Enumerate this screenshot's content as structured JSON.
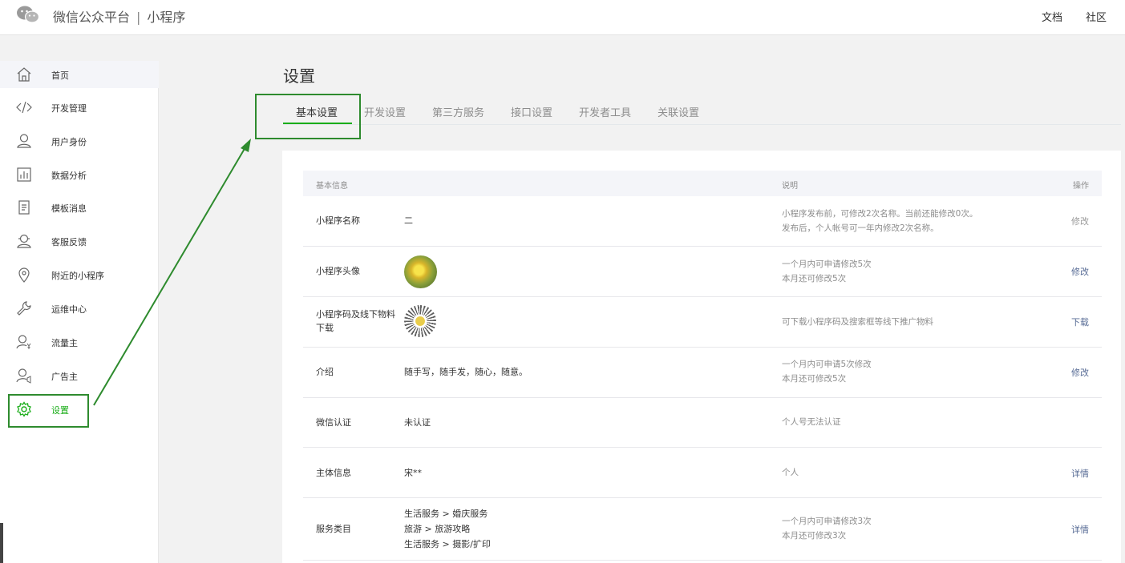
{
  "header": {
    "brand": "微信公众平台",
    "separator": "|",
    "product": "小程序",
    "links": [
      "文档",
      "社区"
    ]
  },
  "sidebar": {
    "items": [
      {
        "label": "首页",
        "icon": "home-icon"
      },
      {
        "label": "开发管理",
        "icon": "code-icon"
      },
      {
        "label": "用户身份",
        "icon": "user-icon"
      },
      {
        "label": "数据分析",
        "icon": "chart-icon"
      },
      {
        "label": "模板消息",
        "icon": "document-icon"
      },
      {
        "label": "客服反馈",
        "icon": "service-icon"
      },
      {
        "label": "附近的小程序",
        "icon": "location-icon"
      },
      {
        "label": "运维中心",
        "icon": "wrench-icon"
      },
      {
        "label": "流量主",
        "icon": "user-yen-icon"
      },
      {
        "label": "广告主",
        "icon": "user-ad-icon"
      },
      {
        "label": "设置",
        "icon": "gear-icon"
      }
    ]
  },
  "main": {
    "title": "设置",
    "tabs": [
      "基本设置",
      "开发设置",
      "第三方服务",
      "接口设置",
      "开发者工具",
      "关联设置"
    ],
    "table": {
      "headers": [
        "基本信息",
        "说明",
        "操作"
      ],
      "rows": [
        {
          "label": "小程序名称",
          "value": "二",
          "desc": [
            "小程序发布前，可修改2次名称。当前还能修改0次。",
            "发布后，个人帐号可一年内修改2次名称。"
          ],
          "op": "修改"
        },
        {
          "label": "小程序头像",
          "value": "",
          "desc": [
            "一个月内可申请修改5次",
            "本月还可修改5次"
          ],
          "op": "修改"
        },
        {
          "label": "小程序码及线下物料下载",
          "value": "",
          "desc": [
            "可下载小程序码及搜索框等线下推广物料"
          ],
          "op": "下载"
        },
        {
          "label": "介绍",
          "value": "随手写，随手发，随心，随意。",
          "desc": [
            "一个月内可申请5次修改",
            "本月还可修改5次"
          ],
          "op": "修改"
        },
        {
          "label": "微信认证",
          "value": "未认证",
          "desc": [
            "个人号无法认证"
          ],
          "op": ""
        },
        {
          "label": "主体信息",
          "value": "宋**",
          "desc": [
            "个人"
          ],
          "op": "详情"
        },
        {
          "label": "服务类目",
          "values": [
            "生活服务 > 婚庆服务",
            "旅游 > 旅游攻略",
            "生活服务 > 摄影/扩印"
          ],
          "desc": [
            "一个月内可申请修改3次",
            "本月还可修改3次"
          ],
          "op": "详情"
        }
      ]
    }
  },
  "colors": {
    "accent": "#1aad19",
    "link": "#576b95",
    "annotation": "#2e8b2e"
  }
}
